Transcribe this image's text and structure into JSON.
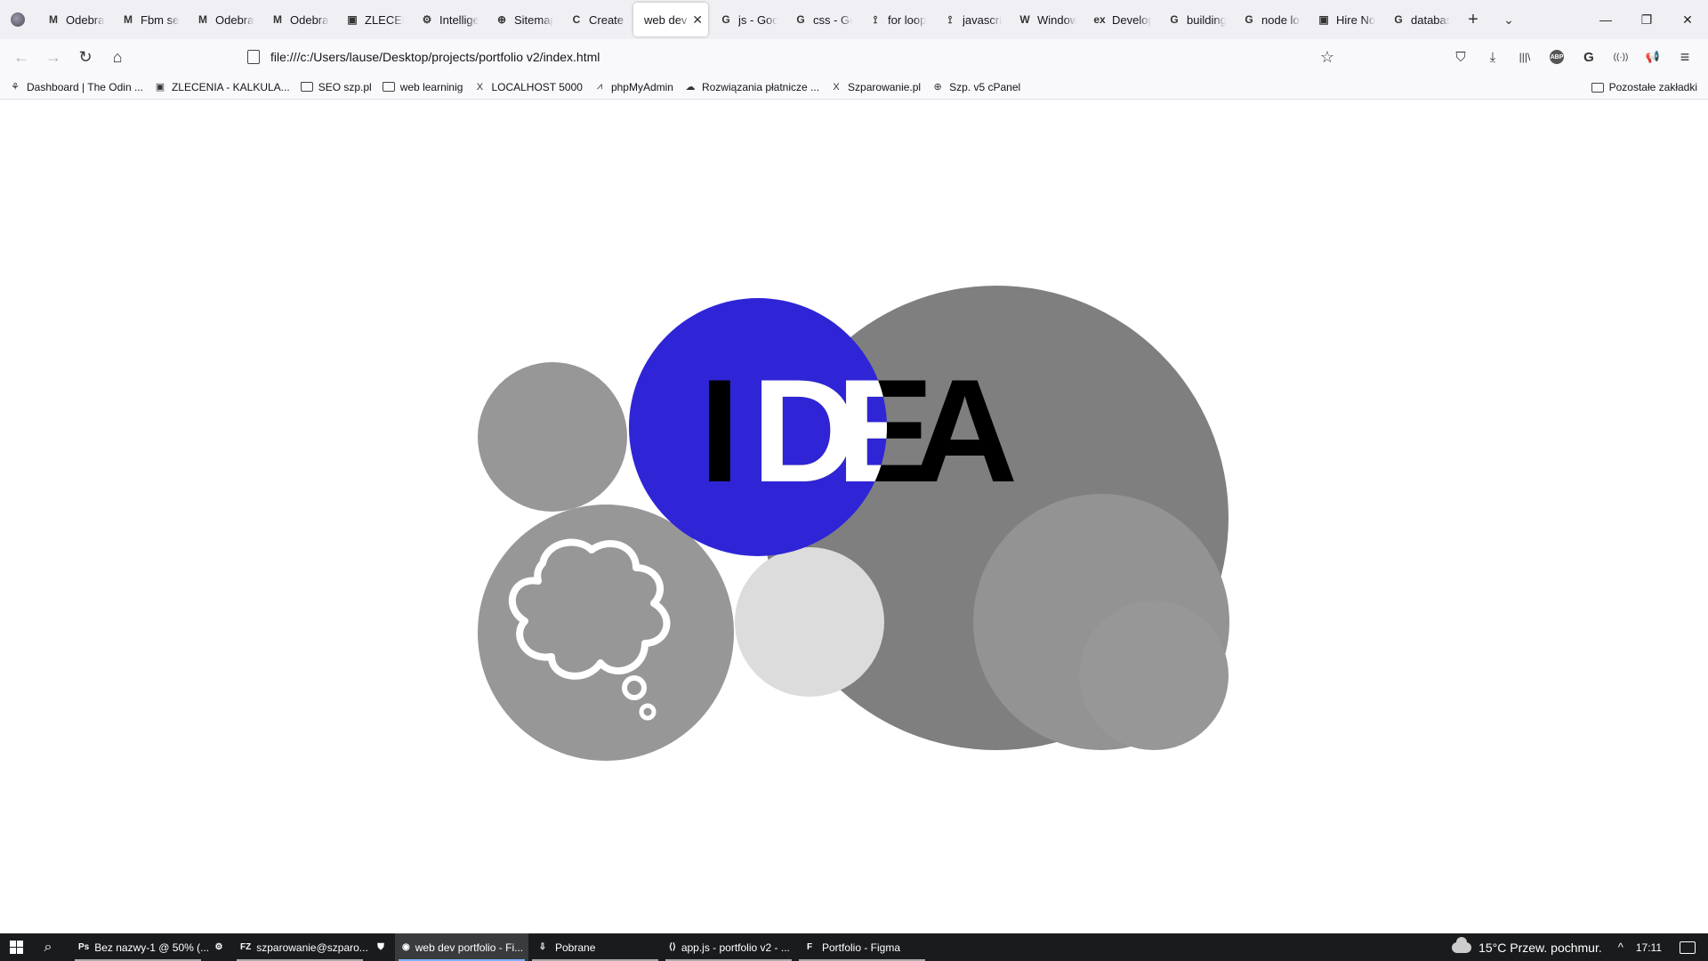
{
  "browser": {
    "tabs": [
      {
        "favicon": "M",
        "label": "Odebrane",
        "active": false
      },
      {
        "favicon": "M",
        "label": "Fbm sekcja",
        "active": false
      },
      {
        "favicon": "M",
        "label": "Odebrane",
        "active": false
      },
      {
        "favicon": "M",
        "label": "Odebrane",
        "active": false
      },
      {
        "favicon": "▣",
        "label": "ZLECENIA",
        "active": false
      },
      {
        "favicon": "⚙",
        "label": "Intelligence",
        "active": false
      },
      {
        "favicon": "⊕",
        "label": "Sitemap",
        "active": false
      },
      {
        "favicon": "C",
        "label": "Create a",
        "active": false
      },
      {
        "favicon": "",
        "label": "web dev portfolio",
        "active": true
      },
      {
        "favicon": "G",
        "label": "js - Google",
        "active": false
      },
      {
        "favicon": "G",
        "label": "css - Google",
        "active": false
      },
      {
        "favicon": "⟟",
        "label": "for loop",
        "active": false
      },
      {
        "favicon": "⟟",
        "label": "javascript",
        "active": false
      },
      {
        "favicon": "W",
        "label": "Windows",
        "active": false
      },
      {
        "favicon": "ex",
        "label": "Developers",
        "active": false
      },
      {
        "favicon": "G",
        "label": "building",
        "active": false
      },
      {
        "favicon": "G",
        "label": "node local",
        "active": false
      },
      {
        "favicon": "▣",
        "label": "Hire Now",
        "active": false
      },
      {
        "favicon": "G",
        "label": "database",
        "active": false
      }
    ],
    "close_glyph": "✕",
    "new_tab_glyph": "+",
    "tab_list_glyph": "⌄",
    "window_controls": {
      "minimize": "—",
      "restore": "❐",
      "close": "✕"
    },
    "nav": {
      "back": "←",
      "forward": "→",
      "reload": "↻",
      "home": "⌂",
      "star": "☆"
    },
    "url": "file:///c:/Users/lause/Desktop/projects/portfolio v2/index.html",
    "toolbar_icons": {
      "pocket": "⛉",
      "downloads": "⤓",
      "library": "|||\\",
      "adblock": "ABP",
      "grammarly": "G",
      "extension": "((·))",
      "megaphone": "📢",
      "menu": "≡"
    },
    "bookmarks": [
      {
        "icon": "⚘",
        "label": "Dashboard | The Odin ..."
      },
      {
        "icon": "▣",
        "label": "ZLECENIA - KALKULA..."
      },
      {
        "icon": "folder",
        "label": "SEO szp.pl"
      },
      {
        "icon": "folder",
        "label": "web learninig"
      },
      {
        "icon": "X",
        "label": "LOCALHOST 5000"
      },
      {
        "icon": "⩘",
        "label": "phpMyAdmin"
      },
      {
        "icon": "☁",
        "label": "Rozwiązania płatnicze ..."
      },
      {
        "icon": "X",
        "label": "Szparowanie.pl"
      },
      {
        "icon": "⊕",
        "label": "Szp. v5 cPanel"
      }
    ],
    "other_bookmarks": "Pozostałe zakładki"
  },
  "page": {
    "headline_letters": [
      "I",
      "D",
      "E",
      "A"
    ],
    "colors": {
      "accent_blue": "#2f25d6",
      "big_gray": "#7f7f7f",
      "mid_gray": "#979797",
      "light_gray": "#dcdcdc",
      "black": "#000000",
      "white": "#ffffff"
    }
  },
  "taskbar": {
    "items": [
      {
        "icon": "Ps",
        "label": "Bez nazwy-1 @ 50% (...",
        "state": "open"
      },
      {
        "icon": "⚙",
        "label": "",
        "state": "narrow"
      },
      {
        "icon": "FZ",
        "label": "szparowanie@szparo...",
        "state": "open"
      },
      {
        "icon": "⛊",
        "label": "",
        "state": "narrow"
      },
      {
        "icon": "◉",
        "label": "web dev portfolio - Fi...",
        "state": "active"
      },
      {
        "icon": "⇩",
        "label": "Pobrane",
        "state": "open"
      },
      {
        "icon": "⟨⟩",
        "label": "app.js - portfolio v2 - ...",
        "state": "open"
      },
      {
        "icon": "F",
        "label": "Portfolio - Figma",
        "state": "open"
      }
    ],
    "weather": "15°C  Przew. pochmur.",
    "caret": "^",
    "time": "17:11"
  }
}
